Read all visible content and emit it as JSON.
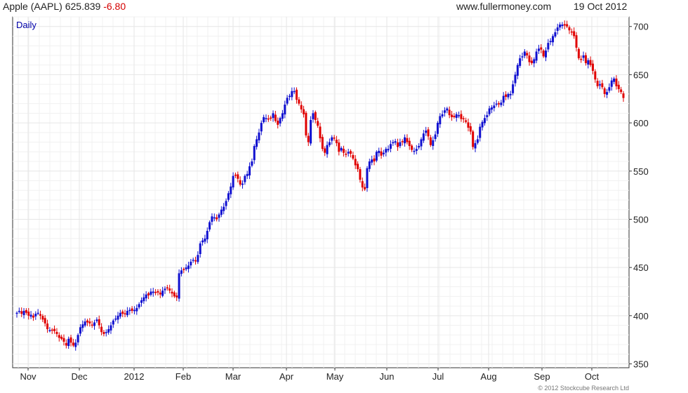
{
  "header": {
    "ticker": "Apple (AAPL)",
    "price": "625.839",
    "change": "-6.80",
    "site": "www.fullermoney.com",
    "date": "19 Oct 2012"
  },
  "footer": {
    "copyright": "© 2012 Stockcube Research Ltd"
  },
  "colors": {
    "up": "#1010d0",
    "down": "#e00000",
    "grid": "#e6e6e6",
    "axis": "#333333",
    "label": "#0000aa"
  },
  "chart_data": {
    "type": "candlestick",
    "period_label": "Daily",
    "x_ticks": [
      "Nov",
      "Dec",
      "2012",
      "Feb",
      "Mar",
      "Apr",
      "May",
      "Jun",
      "Jul",
      "Aug",
      "Sep",
      "Oct"
    ],
    "y_ticks": [
      350,
      400,
      450,
      500,
      550,
      600,
      650,
      700
    ],
    "ylim": [
      346,
      710
    ],
    "grid": true,
    "closes": [
      403,
      405,
      402,
      405,
      403,
      400,
      401,
      398,
      402,
      403,
      400,
      396,
      392,
      386,
      385,
      385,
      384,
      381,
      377,
      376,
      373,
      369,
      376,
      372,
      369,
      372,
      380,
      388,
      391,
      394,
      393,
      392,
      390,
      393,
      396,
      390,
      383,
      381,
      383,
      386,
      390,
      395,
      397,
      400,
      403,
      402,
      402,
      405,
      406,
      405,
      406,
      408,
      412,
      416,
      419,
      422,
      421,
      425,
      425,
      424,
      424,
      422,
      426,
      428,
      429,
      426,
      423,
      420,
      419,
      444,
      447,
      448,
      450,
      452,
      456,
      458,
      457,
      463,
      475,
      478,
      480,
      488,
      497,
      503,
      502,
      500,
      505,
      510,
      513,
      519,
      527,
      534,
      545,
      546,
      542,
      536,
      537,
      545,
      547,
      555,
      560,
      576,
      583,
      590,
      600,
      606,
      605,
      604,
      605,
      610,
      602,
      598,
      605,
      610,
      619,
      626,
      628,
      633,
      633,
      624,
      620,
      614,
      609,
      587,
      580,
      603,
      610,
      603,
      597,
      584,
      573,
      569,
      577,
      580,
      585,
      584,
      579,
      570,
      574,
      569,
      567,
      570,
      568,
      563,
      556,
      552,
      541,
      533,
      531,
      553,
      560,
      562,
      560,
      570,
      571,
      566,
      569,
      573,
      573,
      578,
      580,
      581,
      575,
      580,
      580,
      585,
      580,
      576,
      572,
      571,
      573,
      576,
      583,
      589,
      592,
      586,
      577,
      582,
      588,
      600,
      607,
      609,
      613,
      615,
      608,
      606,
      606,
      609,
      608,
      604,
      604,
      601,
      595,
      591,
      575,
      579,
      583,
      596,
      601,
      605,
      608,
      615,
      616,
      618,
      620,
      620,
      621,
      628,
      627,
      630,
      630,
      640,
      650,
      660,
      667,
      669,
      674,
      670,
      663,
      662,
      666,
      674,
      677,
      676,
      669,
      675,
      683,
      685,
      690,
      694,
      699,
      702,
      702,
      701,
      700,
      696,
      694,
      690,
      678,
      667,
      666,
      670,
      662,
      665,
      660,
      654,
      645,
      638,
      640,
      637,
      630,
      632,
      637,
      644,
      646,
      638,
      635,
      632,
      625.839
    ]
  }
}
